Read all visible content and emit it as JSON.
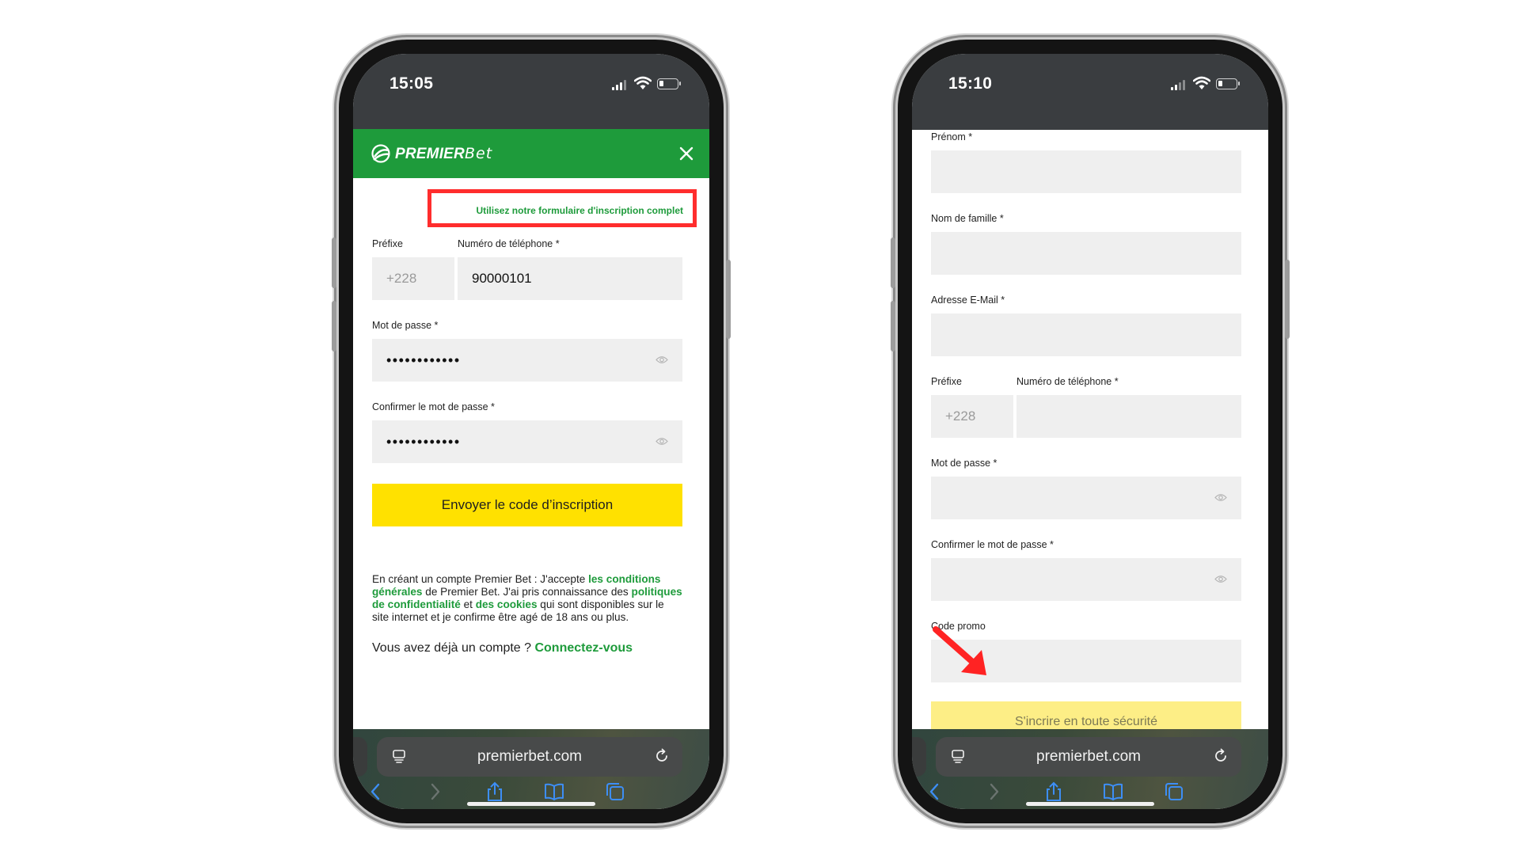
{
  "left_phone": {
    "status": {
      "time": "15:05"
    },
    "header": {
      "brand_strong": "PREMIER",
      "brand_light": "Bet"
    },
    "full_form_link": "Utilisez notre formulaire d'inscription complet",
    "prefix_label": "Préfixe",
    "prefix_placeholder": "+228",
    "phone_label": "Numéro de téléphone *",
    "phone_value": "90000101",
    "password_label": "Mot de passe *",
    "password_value": "••••••••••••",
    "confirm_label": "Confirmer le mot de passe *",
    "confirm_value": "••••••••••••",
    "send_code_button": "Envoyer le code d’inscription",
    "terms": {
      "t1": "En créant un compte Premier Bet : J'accepte ",
      "l1": "les conditions générales",
      "t2": " de Premier Bet. J'ai pris connaissance des ",
      "l2": "politiques de confidentialité",
      "t3": " et ",
      "l3": "des cookies",
      "t4": " qui sont disponibles sur le site internet et je confirme être agé de 18 ans ou plus."
    },
    "login_prompt": "Vous avez déjà un compte ? ",
    "login_link": "Connectez-vous",
    "browser": {
      "url": "premierbet.com"
    }
  },
  "right_phone": {
    "status": {
      "time": "15:10"
    },
    "first_name_label": "Prénom *",
    "last_name_label": "Nom de famille *",
    "email_label": "Adresse E-Mail *",
    "prefix_label": "Préfixe",
    "prefix_placeholder": "+228",
    "phone_label": "Numéro de téléphone *",
    "password_label": "Mot de passe *",
    "confirm_label": "Confirmer le mot de passe *",
    "promo_label": "Code promo",
    "register_button": "S'incrire en toute sécurité",
    "browser": {
      "url": "premierbet.com"
    }
  },
  "colors": {
    "brand_green": "#1e9b3b",
    "button_yellow": "#ffe100",
    "highlight_red": "#ff2d2d",
    "field_gray": "#efefef"
  }
}
